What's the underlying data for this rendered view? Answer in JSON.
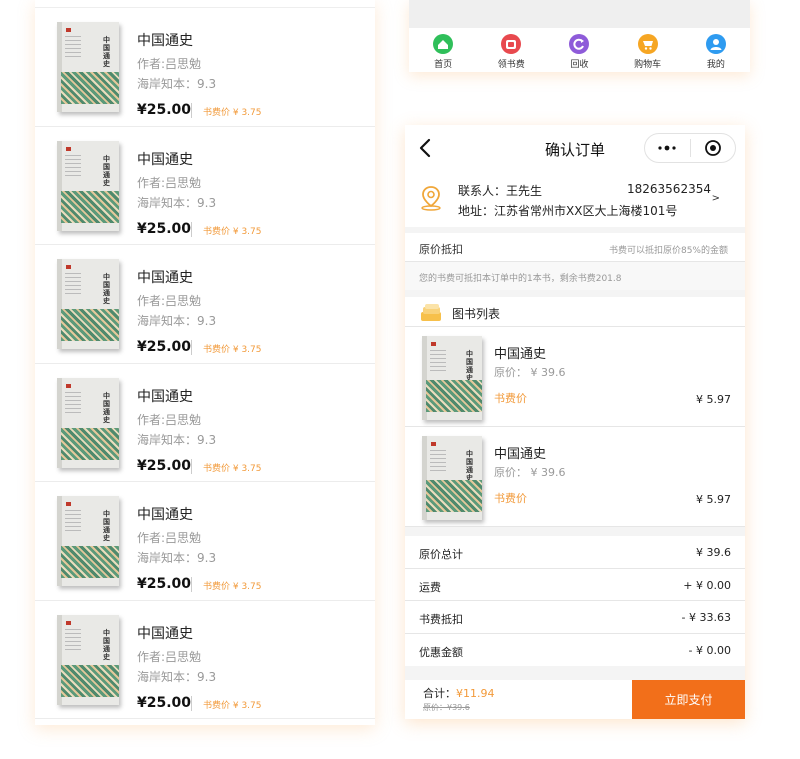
{
  "book_list": [
    {
      "title": "中国通史",
      "author": "作者:吕思勉",
      "rating": "海岸知本：9.3",
      "price": "¥25.00",
      "fee": "书费价 ¥ 3.75"
    },
    {
      "title": "中国通史",
      "author": "作者:吕思勉",
      "rating": "海岸知本：9.3",
      "price": "¥25.00",
      "fee": "书费价 ¥ 3.75"
    },
    {
      "title": "中国通史",
      "author": "作者:吕思勉",
      "rating": "海岸知本：9.3",
      "price": "¥25.00",
      "fee": "书费价 ¥ 3.75"
    },
    {
      "title": "中国通史",
      "author": "作者:吕思勉",
      "rating": "海岸知本：9.3",
      "price": "¥25.00",
      "fee": "书费价 ¥ 3.75"
    },
    {
      "title": "中国通史",
      "author": "作者:吕思勉",
      "rating": "海岸知本：9.3",
      "price": "¥25.00",
      "fee": "书费价 ¥ 3.75"
    },
    {
      "title": "中国通史",
      "author": "作者:吕思勉",
      "rating": "海岸知本：9.3",
      "price": "¥25.00",
      "fee": "书费价 ¥ 3.75"
    }
  ],
  "cover": {
    "title": "中国通史"
  },
  "tabbar": [
    {
      "label": "首页",
      "icon": "home-icon",
      "color": "#2fbf5a"
    },
    {
      "label": "领书费",
      "icon": "wallet-icon",
      "color": "#e8494e"
    },
    {
      "label": "回收",
      "icon": "recycle-icon",
      "color": "#8e5bd9"
    },
    {
      "label": "购物车",
      "icon": "cart-icon",
      "color": "#f6a623"
    },
    {
      "label": "我的",
      "icon": "user-icon",
      "color": "#2e9bf0"
    }
  ],
  "order": {
    "nav_title": "确认订单",
    "address": {
      "contact": "联系人：王先生",
      "phone": "18263562354",
      "address": "地址：江苏省常州市XX区大上海楼101号",
      "arrow": ">"
    },
    "deduct": {
      "title": "原价抵扣",
      "note": "书费可以抵扣原价85%的金额",
      "sub": "您的书费可抵扣本订单中的1本书，剩余书费201.8"
    },
    "list_title": "图书列表",
    "items": [
      {
        "title": "中国通史",
        "orig": "原价： ¥ 39.6",
        "fee_label": "书费价",
        "price": "¥ 5.97"
      },
      {
        "title": "中国通史",
        "orig": "原价： ¥ 39.6",
        "fee_label": "书费价",
        "price": "¥ 5.97"
      }
    ],
    "summary": [
      {
        "label": "原价总计",
        "value": "¥ 39.6"
      },
      {
        "label": "运费",
        "value": "+ ¥ 0.00"
      },
      {
        "label": "书费抵扣",
        "value": "- ¥ 33.63"
      },
      {
        "label": "优惠金额",
        "value": "- ¥ 0.00"
      }
    ],
    "total_label": "合计：",
    "total_value": "¥11.94",
    "total_orig": "原价：¥39.6",
    "pay_label": "立即支付"
  },
  "colors": {
    "accent": "#f29a3a",
    "pay_button": "#f26f1a"
  }
}
